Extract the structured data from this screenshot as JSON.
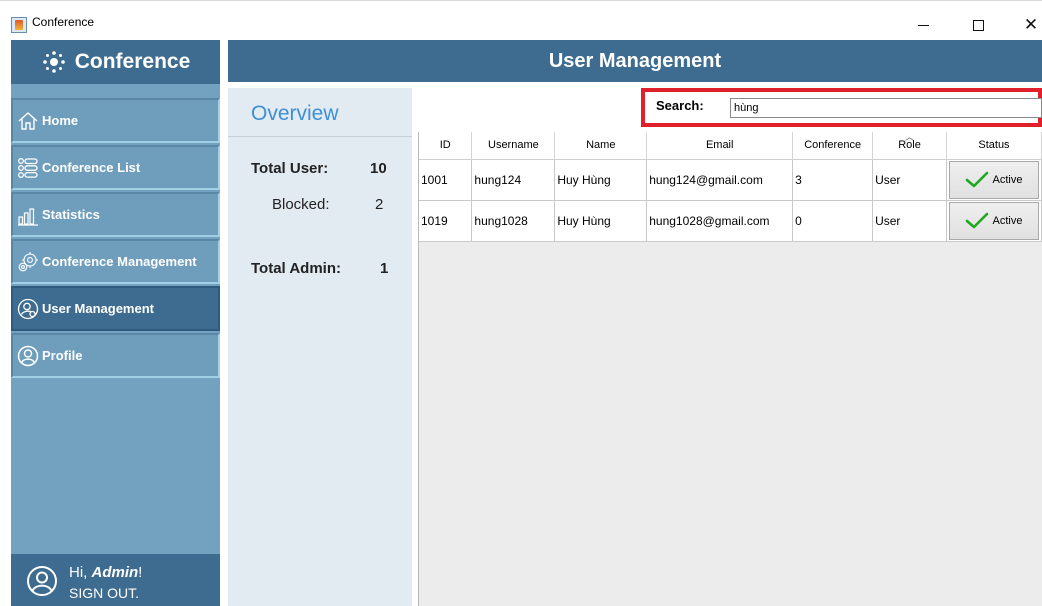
{
  "window": {
    "title": "Conference",
    "minimize_icon": "minimize-icon",
    "maximize_icon": "maximize-icon",
    "close_icon": "close-icon",
    "close_glyph": "✕"
  },
  "sidebar": {
    "logo_text": "Conference",
    "items": [
      {
        "label": "Home",
        "icon": "home-icon",
        "active": false
      },
      {
        "label": "Conference List",
        "icon": "list-icon",
        "active": false
      },
      {
        "label": "Statistics",
        "icon": "bar-chart-icon",
        "active": false
      },
      {
        "label": "Conference Management",
        "icon": "gears-icon",
        "active": false
      },
      {
        "label": "User Management",
        "icon": "user-settings-icon",
        "active": true
      },
      {
        "label": "Profile",
        "icon": "profile-icon",
        "active": false
      }
    ],
    "greeting_prefix": "Hi, ",
    "user_name": "Admin",
    "greeting_suffix": "!",
    "sign_out": "SIGN OUT."
  },
  "header": {
    "title": "User Management"
  },
  "overview": {
    "title": "Overview",
    "total_user_label": "Total User:",
    "total_user_value": "10",
    "blocked_label": "Blocked:",
    "blocked_value": "2",
    "total_admin_label": "Total Admin:",
    "total_admin_value": "1"
  },
  "search": {
    "label": "Search:",
    "value": "hùng"
  },
  "table": {
    "columns": [
      "ID",
      "Username",
      "Name",
      "Email",
      "Conference",
      "Role",
      "Status"
    ],
    "sorted_column": "Role",
    "rows": [
      {
        "id": "1001",
        "username": "hung124",
        "name": "Huy Hùng",
        "email": "hung124@gmail.com",
        "conference": "3",
        "role": "User",
        "status": "Active"
      },
      {
        "id": "1019",
        "username": "hung1028",
        "name": "Huy Hùng",
        "email": "hung1028@gmail.com",
        "conference": "0",
        "role": "User",
        "status": "Active"
      }
    ]
  },
  "colors": {
    "sidebar_dark": "#3e6c90",
    "sidebar_light": "#72a2c0",
    "overview_bg": "#e3ebf2",
    "accent_title": "#3d8fd6",
    "search_highlight": "#e0202a",
    "check_green": "#1fa81f"
  }
}
